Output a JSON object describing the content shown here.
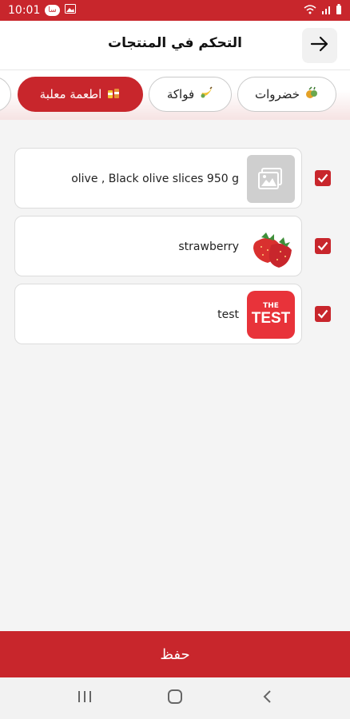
{
  "status_bar": {
    "time": "10:01",
    "badge": "سا"
  },
  "header": {
    "title": "التحكم في المنتجات"
  },
  "tabs": [
    {
      "label": "خضروات",
      "icon": "vegetables-icon",
      "active": false
    },
    {
      "label": "فواكة",
      "icon": "banana-icon",
      "active": false
    },
    {
      "label": "اطعمة معلبة",
      "icon": "canned-food-icon",
      "active": true
    }
  ],
  "products": [
    {
      "name": "olive , Black olive slices 950 g",
      "image": "placeholder-image-icon",
      "checked": true
    },
    {
      "name": "strawberry",
      "image": "strawberry-image",
      "checked": true
    },
    {
      "name": "test",
      "image": "test-logo-image",
      "checked": true
    }
  ],
  "test_logo": {
    "line1": "THE",
    "line2": "TEST"
  },
  "save_button": {
    "label": "حفظ"
  },
  "colors": {
    "accent": "#c8262c",
    "background": "#f4f4f4"
  }
}
